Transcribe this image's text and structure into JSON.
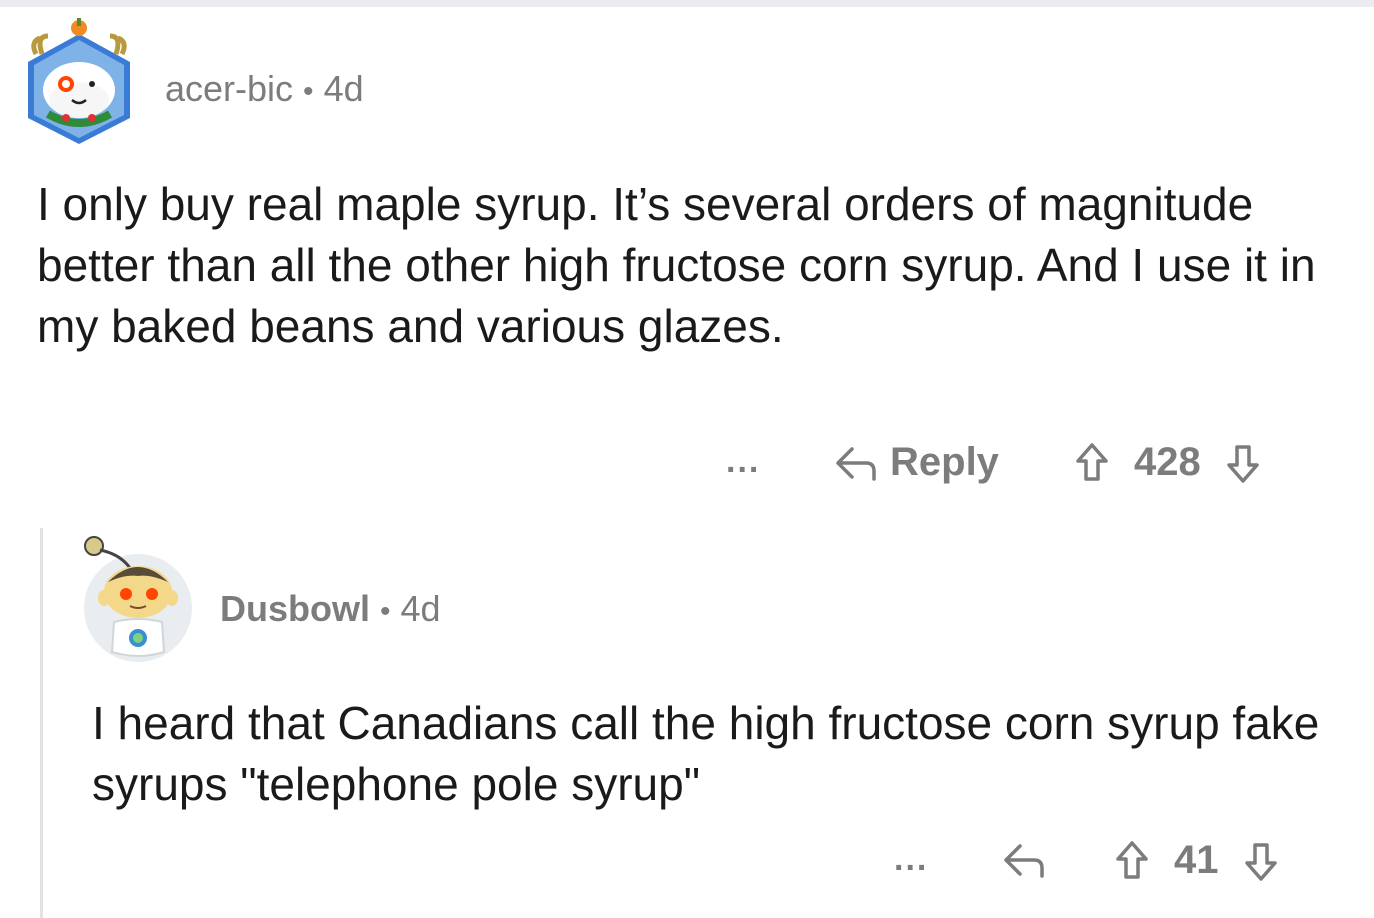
{
  "comments": [
    {
      "author": "acer-bic",
      "separator": "•",
      "age": "4d",
      "text": "I only buy real maple syrup. It’s several orders of magnitude better than all the other high fructose corn syrup. And I use it in my baked beans and various glazes.",
      "more_label": "...",
      "reply_label": "Reply",
      "score": "428"
    },
    {
      "author": "Dusbowl",
      "separator": "•",
      "age": "4d",
      "text": "I heard that Canadians call the high fructose corn syrup fake syrups \"telephone pole syrup\"",
      "more_label": "...",
      "score": "41"
    }
  ],
  "icons": {
    "reply": "reply-arrow-icon",
    "upvote": "upvote-arrow-icon",
    "downvote": "downvote-arrow-icon"
  },
  "colors": {
    "meta_text": "#7c7c7c",
    "body_text": "#1a1a1b",
    "thread_line": "#e2e2e2"
  }
}
